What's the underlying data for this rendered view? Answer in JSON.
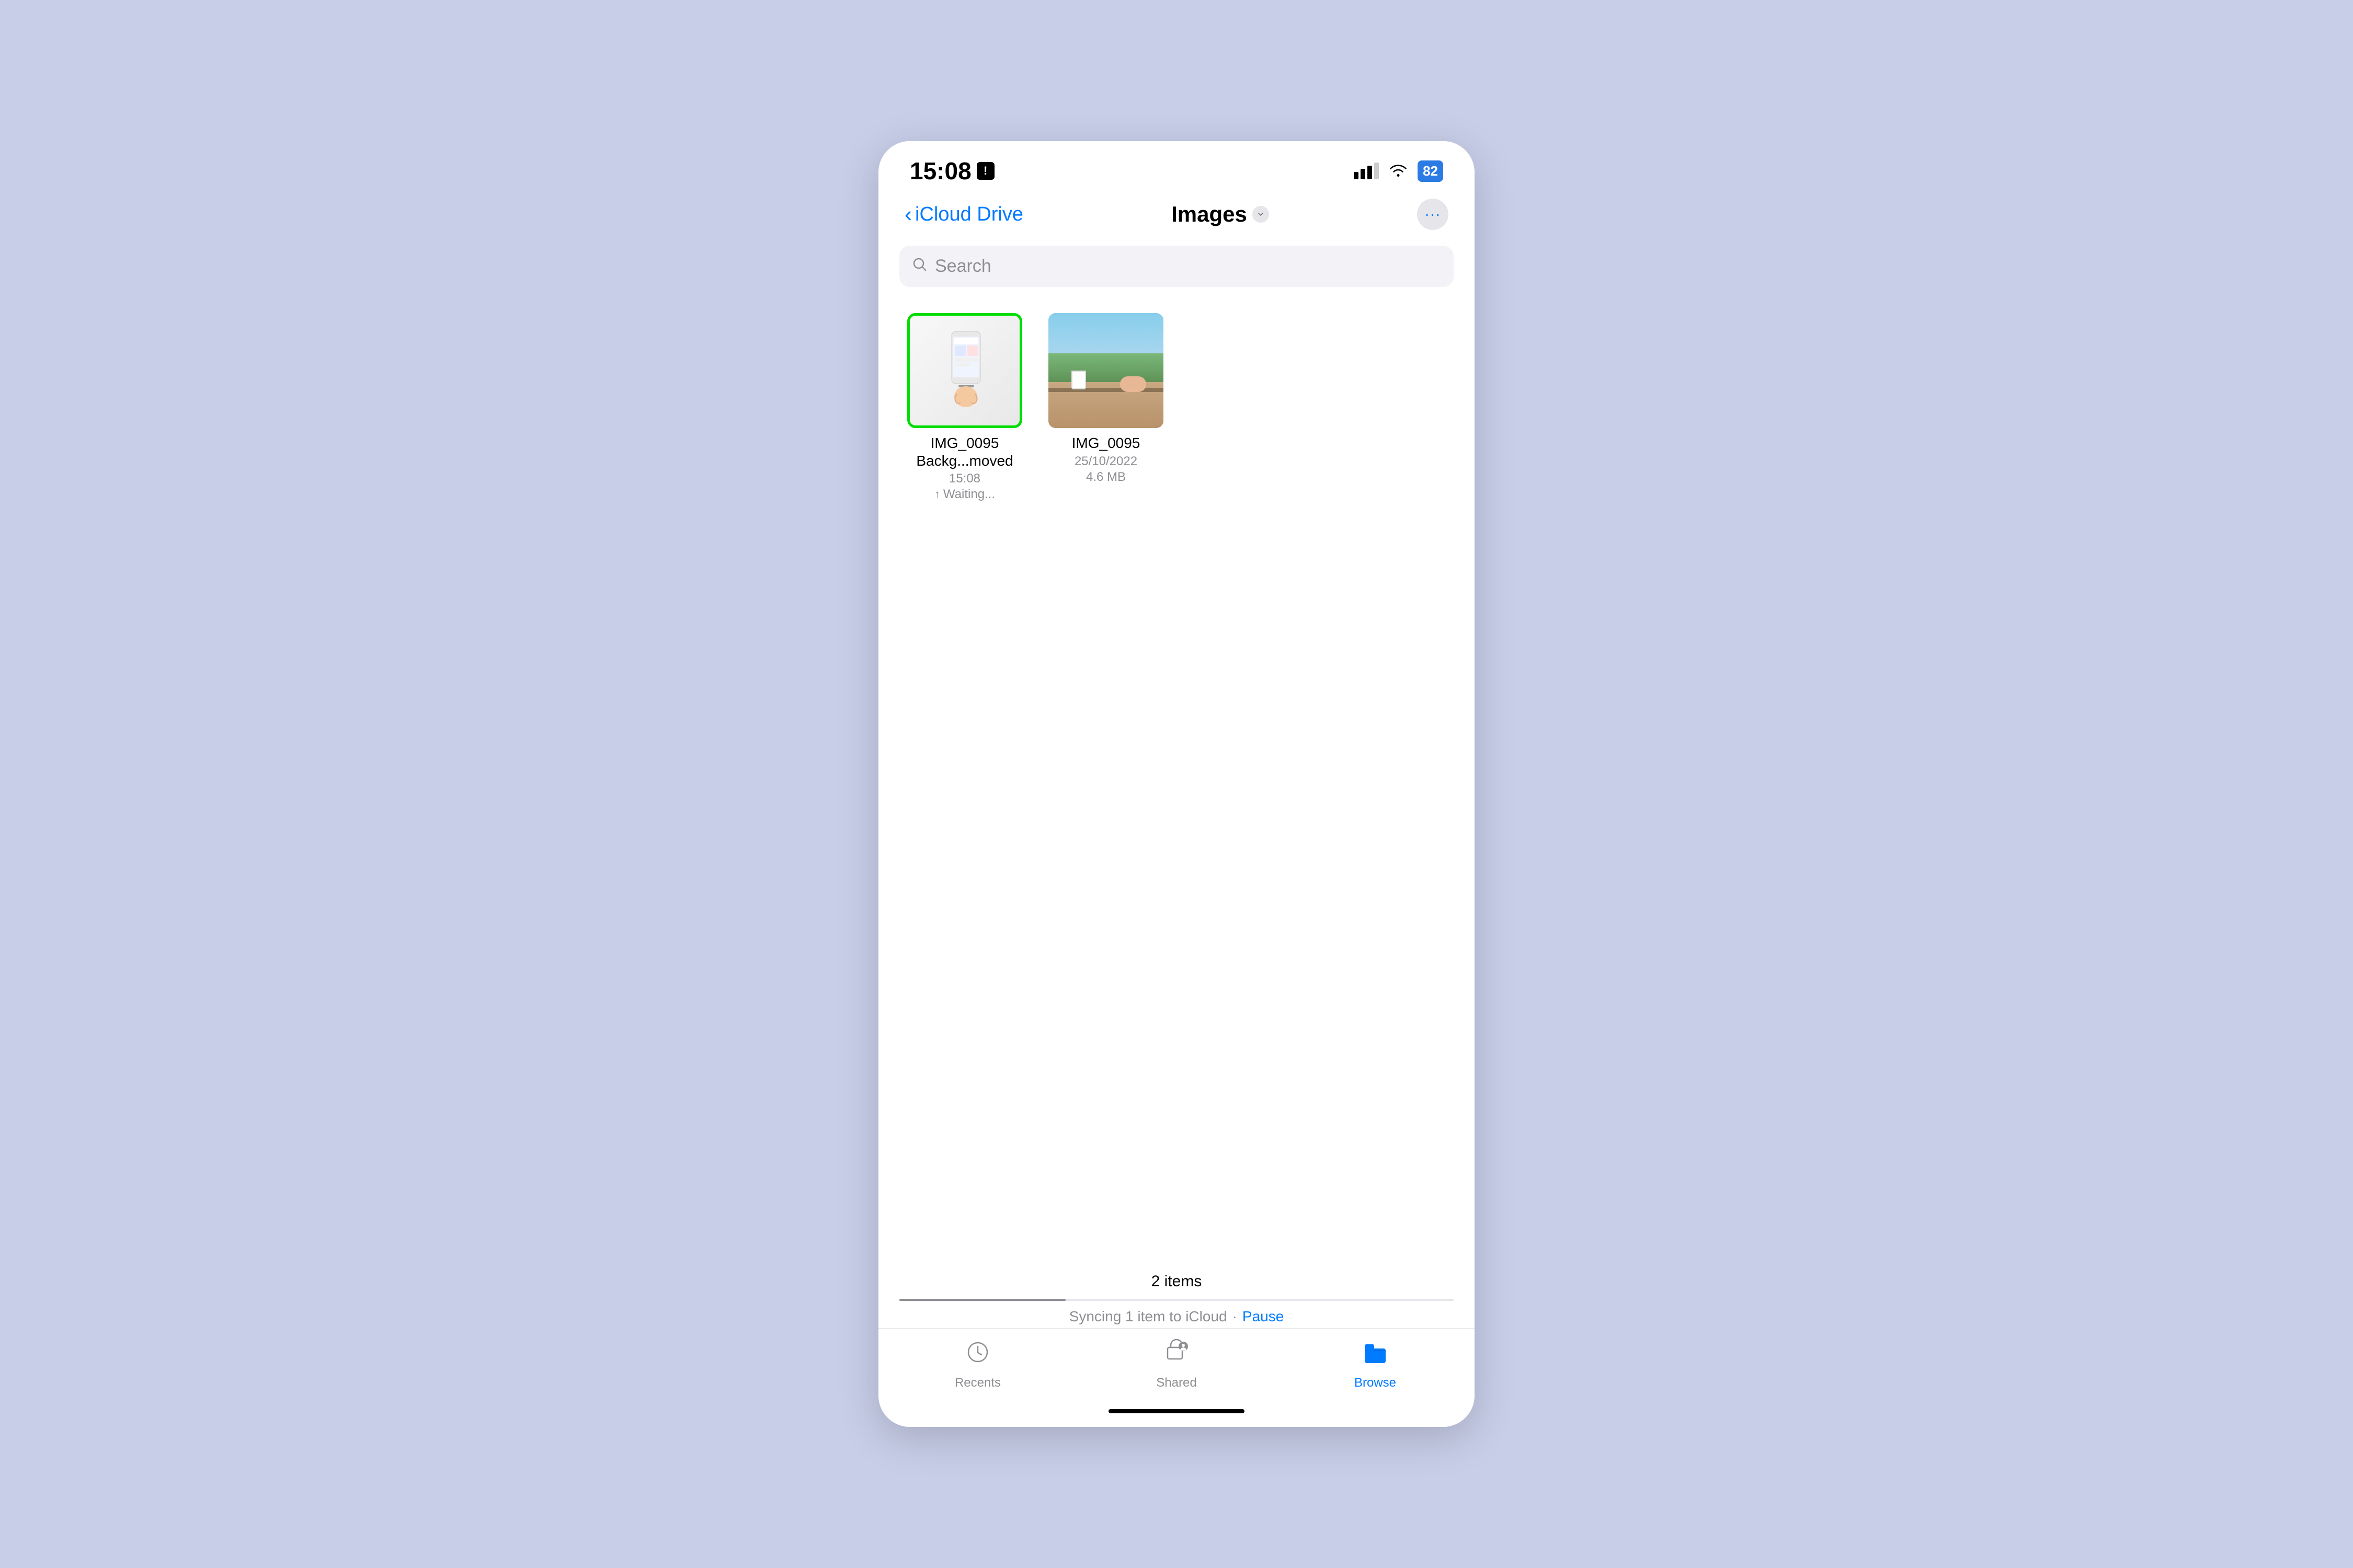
{
  "background_color": "#c8cee8",
  "phone": {
    "status_bar": {
      "time": "15:08",
      "alert_icon": "!",
      "battery": "82"
    },
    "nav": {
      "back_label": "iCloud Drive",
      "title": "Images",
      "more_icon": "•••"
    },
    "search": {
      "placeholder": "Search"
    },
    "files": [
      {
        "id": "file-1",
        "name": "IMG_0095",
        "subtitle": "Backg...moved",
        "time": "15:08",
        "status": "↑ Waiting...",
        "type": "phone-screenshot",
        "selected": true
      },
      {
        "id": "file-2",
        "name": "IMG_0095",
        "date": "25/10/2022",
        "size": "4.6 MB",
        "type": "outdoor-photo",
        "selected": false
      }
    ],
    "footer": {
      "items_count": "2 items",
      "sync_text": "Syncing 1 item to iCloud",
      "sync_dot": "·",
      "pause_label": "Pause"
    },
    "tabs": [
      {
        "id": "recents",
        "label": "Recents",
        "icon": "recents",
        "active": false
      },
      {
        "id": "shared",
        "label": "Shared",
        "icon": "shared",
        "active": false,
        "badge": true
      },
      {
        "id": "browse",
        "label": "Browse",
        "icon": "browse",
        "active": true
      }
    ]
  }
}
